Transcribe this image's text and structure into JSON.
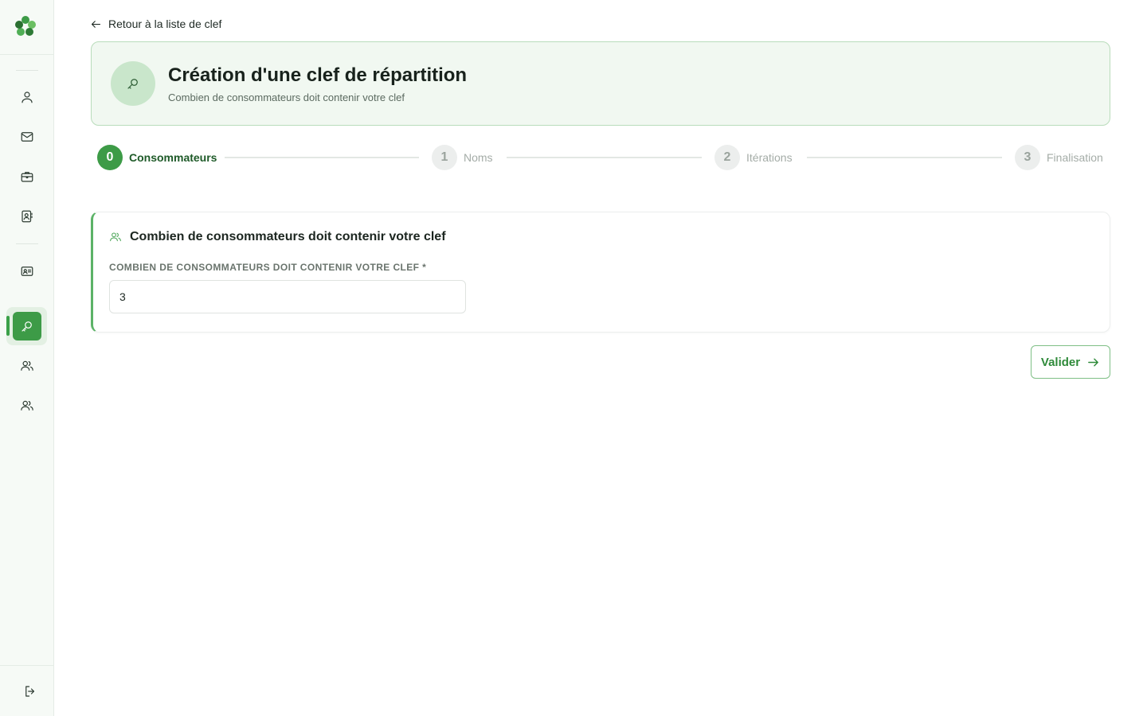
{
  "navigation": {
    "back_label": "Retour à la liste de clef"
  },
  "header": {
    "title": "Création d'une clef de répartition",
    "subtitle": "Combien de consommateurs doit contenir votre clef"
  },
  "stepper": {
    "steps": [
      {
        "number": "0",
        "label": "Consommateurs",
        "state": "active"
      },
      {
        "number": "1",
        "label": "Noms",
        "state": "inactive"
      },
      {
        "number": "2",
        "label": "Itérations",
        "state": "inactive"
      },
      {
        "number": "3",
        "label": "Finalisation",
        "state": "inactive"
      }
    ]
  },
  "form": {
    "section_title": "Combien de consommateurs doit contenir votre clef",
    "field_label": "COMBIEN DE CONSOMMATEURS DOIT CONTENIR VOTRE CLEF *",
    "field_value": "3"
  },
  "actions": {
    "submit_label": "Valider"
  },
  "sidebar": {
    "items": [
      {
        "icon": "user-icon"
      },
      {
        "icon": "mail-icon"
      },
      {
        "icon": "briefcase-icon"
      },
      {
        "icon": "contact-book-icon"
      },
      {
        "icon": "id-card-icon"
      },
      {
        "icon": "key-icon",
        "active": true
      },
      {
        "icon": "users-icon"
      },
      {
        "icon": "users-icon"
      },
      {
        "icon": "logout-icon"
      }
    ]
  },
  "colors": {
    "accent": "#3d9b47",
    "header_bg": "#f1f8f1",
    "header_border": "#b9dcbb"
  }
}
